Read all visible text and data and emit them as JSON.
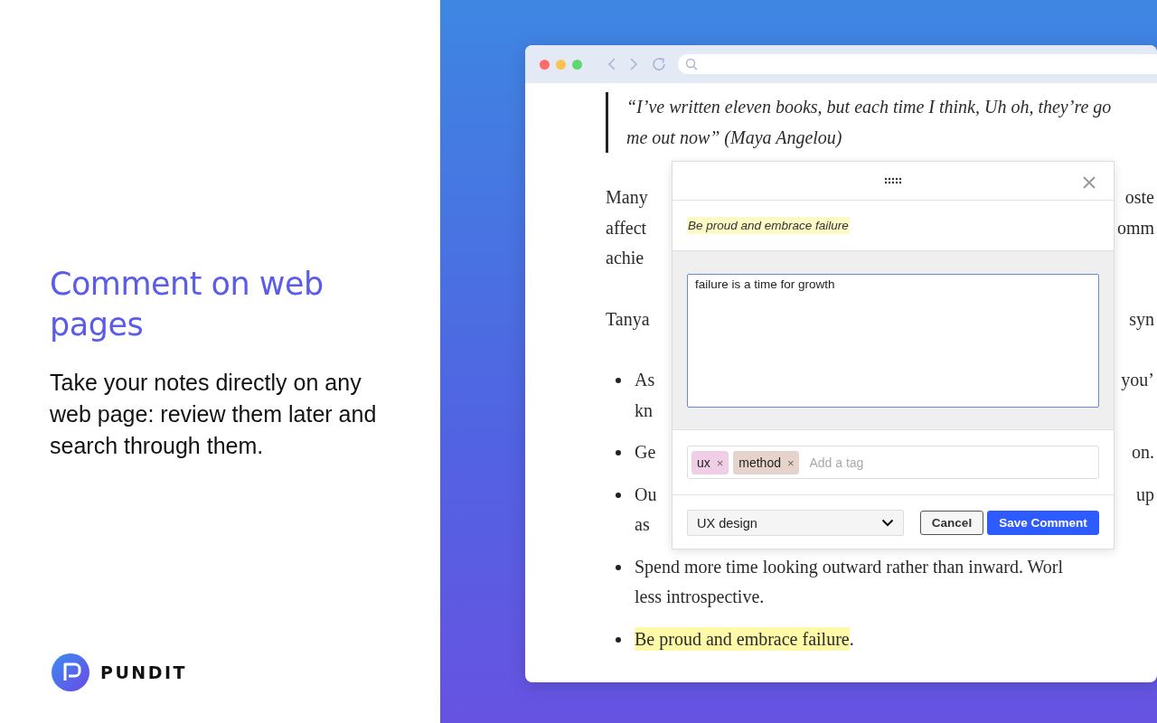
{
  "hero": {
    "title": "Comment on web pages",
    "description": "Take your notes directly on any web page: review them later and search through them."
  },
  "brand": {
    "name": "PUNDIT"
  },
  "article": {
    "quote": [
      "“I’ve written eleven books, but each time I think, Uh oh, they’re go",
      "me out now” (Maya Angelou)"
    ],
    "blocks": [
      {
        "kind": "paragraph",
        "lines": [
          {
            "left": "Many",
            "right": "oste",
            "highlighted": false
          },
          {
            "left": "affect",
            "right": "omm",
            "highlighted": false
          },
          {
            "left": "achie",
            "highlighted": false
          }
        ]
      },
      {
        "kind": "paragraph",
        "lines": [
          {
            "left": "Tanya",
            "right": "syn",
            "highlighted": false
          }
        ]
      },
      {
        "kind": "bullet",
        "lines": [
          {
            "left": "As",
            "right": "you’",
            "highlighted": false
          },
          {
            "left": "kn",
            "highlighted": false
          }
        ]
      },
      {
        "kind": "bullet",
        "lines": [
          {
            "left": "Ge",
            "right": "on.",
            "highlighted": false
          }
        ]
      },
      {
        "kind": "bullet",
        "lines": [
          {
            "left": "Ou",
            "right": "up",
            "highlighted": false
          },
          {
            "left": "as",
            "highlighted": false
          }
        ]
      },
      {
        "kind": "bullet",
        "lines": [
          {
            "left": "Spend more time looking outward rather than inward. Worl",
            "highlighted": false
          },
          {
            "left": "less introspective.",
            "highlighted": false
          }
        ]
      },
      {
        "kind": "bullet",
        "lines": [
          {
            "left": "Be proud and embrace failure",
            "tail": ".",
            "highlighted": true
          }
        ]
      }
    ]
  },
  "annotation": {
    "highlight": "Be proud and embrace failure",
    "comment": "failure is a time for growth",
    "tags": [
      {
        "label": "ux",
        "remove": "×",
        "color": "#f0cfe6"
      },
      {
        "label": "method",
        "remove": "×",
        "color": "#e6d3cc"
      }
    ],
    "tag_placeholder": "Add a tag",
    "notebook": "UX design",
    "buttons": [
      {
        "label": "Cancel",
        "kind": "secondary"
      },
      {
        "label": "Save Comment",
        "kind": "primary"
      }
    ]
  }
}
